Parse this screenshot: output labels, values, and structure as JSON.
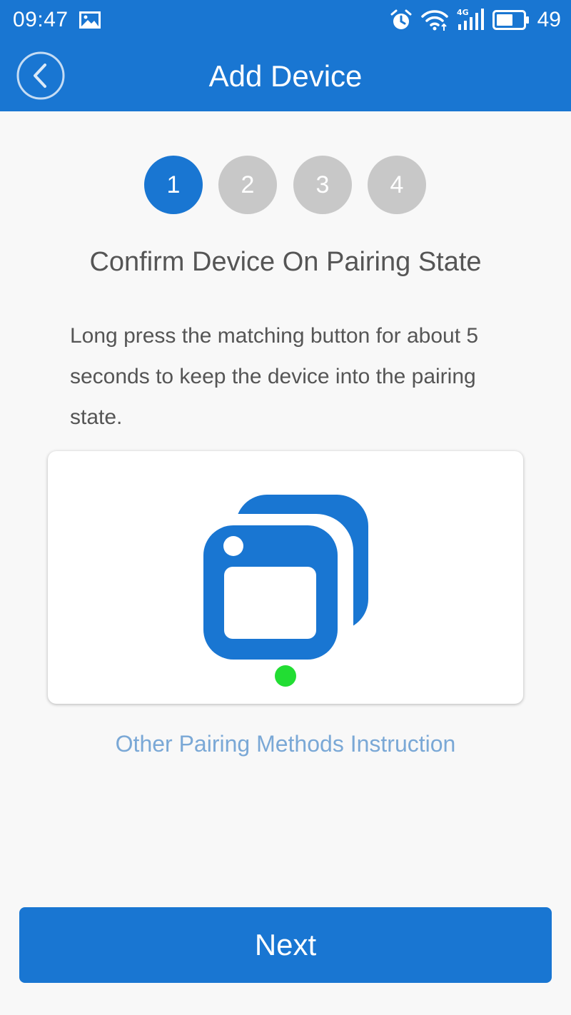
{
  "status_bar": {
    "time": "09:47",
    "battery": "49",
    "icons": [
      "image-icon",
      "alarm-icon",
      "wifi-icon",
      "signal-4g-icon",
      "battery-icon"
    ]
  },
  "header": {
    "title": "Add Device",
    "back_icon": "chevron-left-icon"
  },
  "steps": {
    "items": [
      "1",
      "2",
      "3",
      "4"
    ],
    "current": 1
  },
  "content": {
    "title": "Confirm Device On Pairing State",
    "instructions": "Long press the matching button for about 5 seconds to keep the device into the pairing state.",
    "other_methods_link": "Other Pairing Methods Instruction"
  },
  "footer": {
    "next_label": "Next"
  },
  "colors": {
    "primary": "#1976d2",
    "step_inactive": "#c8c8c8",
    "link": "#7aa8d6",
    "indicator_led": "#22dd33",
    "text": "#555555"
  }
}
